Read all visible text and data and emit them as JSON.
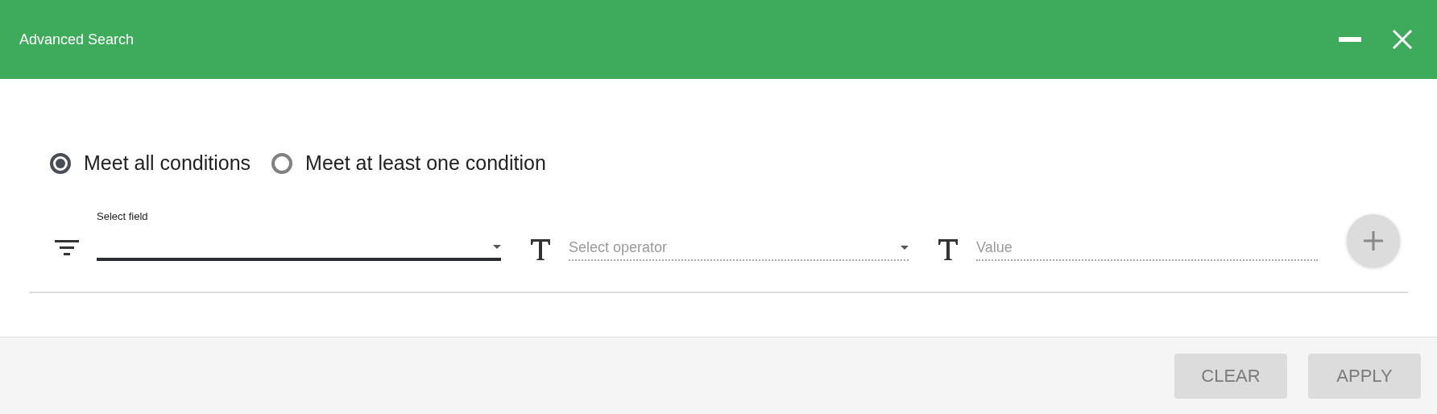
{
  "window": {
    "title": "Advanced Search"
  },
  "match_mode": [
    {
      "label": "Meet all conditions",
      "selected": true
    },
    {
      "label": "Meet at least one condition",
      "selected": false
    }
  ],
  "condition": {
    "field": {
      "label": "Select field",
      "disabled": false
    },
    "operator": {
      "placeholder": "Select operator",
      "disabled": true
    },
    "value": {
      "placeholder": "Value",
      "disabled": true
    },
    "add_disabled": true
  },
  "buttons": [
    {
      "label": "CLEAR",
      "disabled": true
    },
    {
      "label": "APPLY",
      "disabled": true
    }
  ]
}
